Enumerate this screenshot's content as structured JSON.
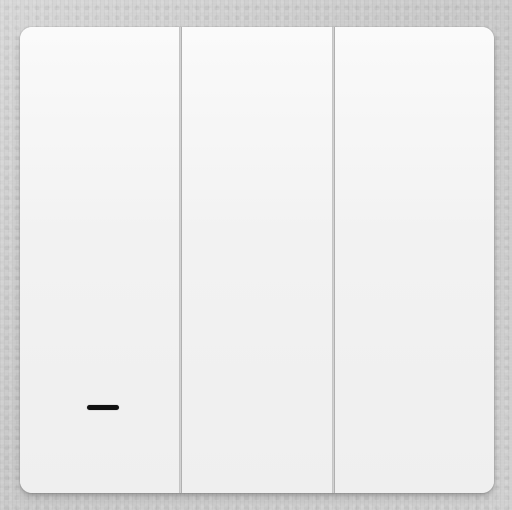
{
  "scene": {
    "subject": "three-gang-wall-switch",
    "colors": {
      "panel": "#f4f4f4",
      "indicator": "#111111",
      "background": "#cfcfcf"
    }
  },
  "switches": [
    {
      "indicator_visible": true
    },
    {
      "indicator_visible": true
    },
    {
      "indicator_visible": true
    }
  ]
}
